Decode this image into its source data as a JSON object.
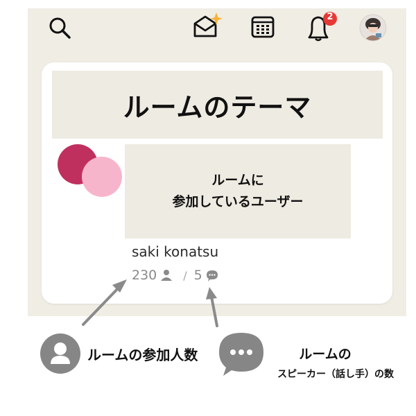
{
  "header": {
    "icons": [
      "search-icon",
      "invite-mail-icon",
      "calendar-icon",
      "bell-icon",
      "avatar"
    ],
    "notification_count": "2",
    "badge_color": "#e53935"
  },
  "room": {
    "theme": "ルームのテーマ",
    "users_placeholder_line1": "ルームに",
    "users_placeholder_line2": "参加しているユーザー",
    "username": "saki konatsu",
    "participants": "230",
    "separator": "/",
    "speakers": "5"
  },
  "annotations": {
    "participants_label": "ルームの参加人数",
    "speakers_label_line1": "ルームの",
    "speakers_label_line2": "スピーカー（話し手）の数"
  },
  "colors": {
    "avatar_primary": "#c0305f",
    "avatar_secondary": "#f7b5cc",
    "background": "#f0ede4"
  }
}
